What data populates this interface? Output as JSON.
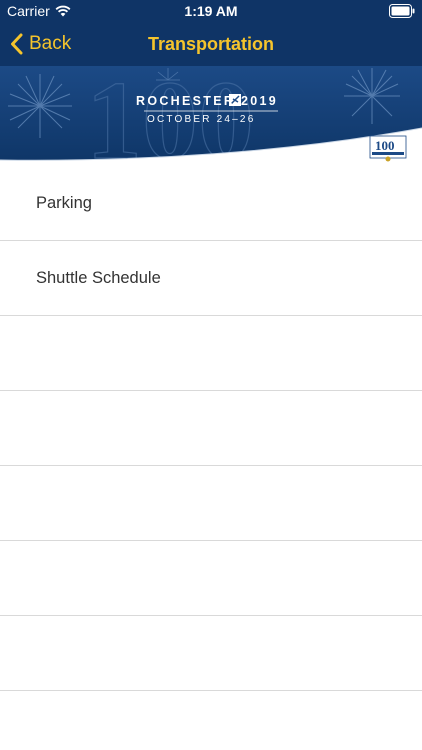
{
  "status_bar": {
    "carrier": "Carrier",
    "time": "1:19 AM",
    "icons": [
      "wifi-icon",
      "battery-icon"
    ]
  },
  "nav": {
    "back_label": "Back",
    "title": "Transportation",
    "accent_color": "#f5c42c",
    "bar_color": "#0f3466"
  },
  "banner": {
    "city_year": "ROCHESTER 2019",
    "dates": "OCTOBER 24–26",
    "decoration": "100"
  },
  "list": {
    "items": [
      {
        "label": "Parking"
      },
      {
        "label": "Shuttle Schedule"
      },
      {
        "label": ""
      },
      {
        "label": ""
      },
      {
        "label": ""
      },
      {
        "label": ""
      },
      {
        "label": ""
      },
      {
        "label": ""
      }
    ]
  }
}
